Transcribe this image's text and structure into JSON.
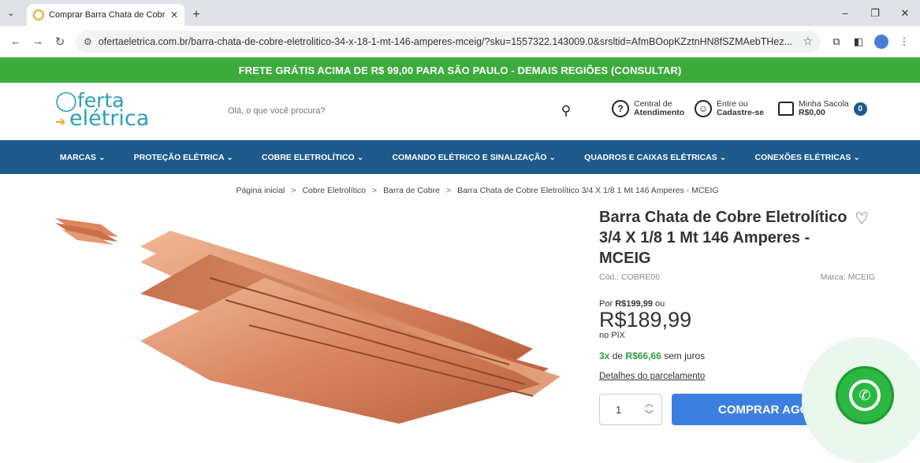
{
  "browser": {
    "tab_title": "Comprar Barra Chata de Cobre",
    "new_tab": "+",
    "url": "ofertaeletrica.com.br/barra-chata-de-cobre-eletrolitico-34-x-18-1-mt-146-amperes-mceig/?sku=1557322.143009.0&srsltid=AfmBOopKZztnHN8fSZMAebTHez...",
    "min": "–",
    "max": "❐",
    "close": "✕"
  },
  "promo": "FRETE GRÁTIS ACIMA DE R$ 99,00 PARA SÃO PAULO - DEMAIS REGIÕES (CONSULTAR)",
  "header": {
    "logo_top": "ferta",
    "logo_bottom": "elétrica",
    "search_placeholder": "Olá, o que você procura?",
    "support_line1": "Central de",
    "support_line2": "Atendimento",
    "account_line1": "Entre ou",
    "account_line2": "Cadastre-se",
    "cart_line1": "Minha Sacola",
    "cart_line2": "R$0,00",
    "cart_count": "0"
  },
  "nav": [
    "MARCAS ⌄",
    "PROTEÇÃO ELÉTRICA ⌄",
    "COBRE ELETROLÍTICO ⌄",
    "COMANDO ELÉTRICO E SINALIZAÇÃO ⌄",
    "QUADROS E CAIXAS ELÉTRICAS ⌄",
    "CONEXÕES ELÉTRICAS ⌄"
  ],
  "breadcrumb": [
    "Página inicial",
    "Cobre Eletrolítico",
    "Barra de Cobre",
    "Barra Chata de Cobre Eletrolítico 3/4 X 1/8 1 Mt 146 Amperes - MCEIG"
  ],
  "product": {
    "title": "Barra Chata de Cobre Eletrolítico 3/4 X 1/8 1 Mt 146 Amperes - MCEIG",
    "code": "Cód.: COBRE06",
    "brand": "Marca: MCEIG",
    "por_label": "Por",
    "old_price": "R$199,99",
    "ou": "ou",
    "price": "R$189,99",
    "pix": "no PIX",
    "installments_n": "3x",
    "installments_de": "de",
    "installments_value": "R$66,66",
    "installments_suffix": "sem juros",
    "details_link": "Detalhes do parcelamento",
    "qty": "1",
    "buy_label": "COMPRAR AGORA"
  }
}
